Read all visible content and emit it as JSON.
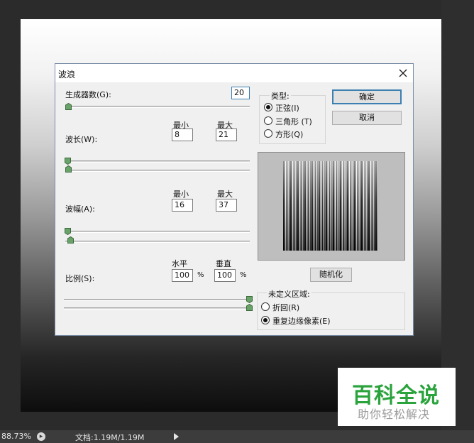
{
  "statusbar": {
    "zoom": "88.73%",
    "doc_info": "文档:1.19M/1.19M"
  },
  "dialog": {
    "title": "波浪",
    "generators": {
      "label": "生成器数(G):",
      "value": "20"
    },
    "wavelength": {
      "label": "波长(W):",
      "min_label": "最小",
      "max_label": "最大",
      "min": "8",
      "max": "21"
    },
    "amplitude": {
      "label": "波幅(A):",
      "min_label": "最小",
      "max_label": "最大",
      "min": "16",
      "max": "37"
    },
    "scale": {
      "label": "比例(S):",
      "h_label": "水平",
      "v_label": "垂直",
      "h": "100",
      "v": "100",
      "unit": "%"
    },
    "type_group": {
      "title": "类型:",
      "options": [
        "正弦(I)",
        "三角形 (T)",
        "方形(Q)"
      ],
      "selected": 0
    },
    "buttons": {
      "ok": "确定",
      "cancel": "取消",
      "randomize": "随机化"
    },
    "undefined_area": {
      "title": "未定义区域:",
      "options": [
        "折回(R)",
        "重复边缘像素(E)"
      ],
      "selected": 1
    }
  },
  "watermark": {
    "main": "百科全说",
    "sub": "助你轻松解决"
  },
  "colors": {
    "ok_border": "#3c7fb1",
    "watermark_green": "#2aa33c",
    "thumb_green": "#6aa36a"
  },
  "icons": {
    "close": "close-icon",
    "slider_thumb": "slider-thumb-icon",
    "status": "status-info-icon",
    "play": "play-arrow-icon"
  }
}
